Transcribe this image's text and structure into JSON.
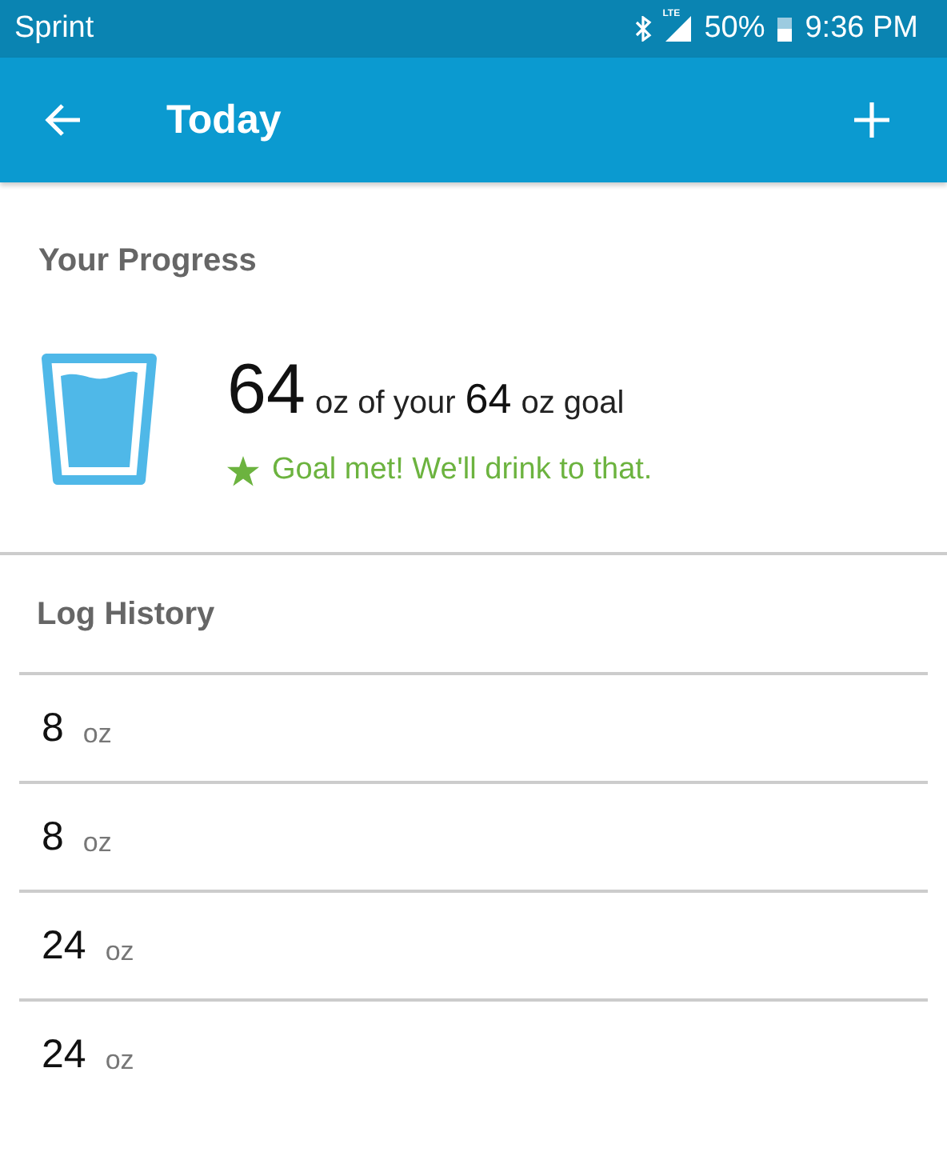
{
  "status_bar": {
    "carrier": "Sprint",
    "network": "LTE",
    "battery": "50%",
    "time": "9:36 PM"
  },
  "app_bar": {
    "title": "Today"
  },
  "progress": {
    "heading": "Your Progress",
    "amount": "64",
    "amount_unit": "oz of your",
    "goal": "64",
    "goal_unit": "oz goal",
    "goal_met": true,
    "message": "Goal met! We'll drink to that."
  },
  "log_history": {
    "heading": "Log History",
    "entries": [
      {
        "amount": "8",
        "unit": "oz"
      },
      {
        "amount": "8",
        "unit": "oz"
      },
      {
        "amount": "24",
        "unit": "oz"
      },
      {
        "amount": "24",
        "unit": "oz"
      }
    ]
  }
}
